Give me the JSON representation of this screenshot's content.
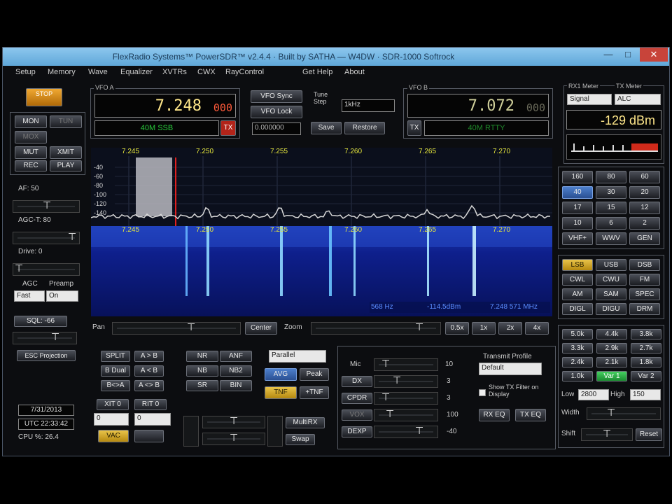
{
  "window": {
    "title": "FlexRadio Systems™ PowerSDR™ v2.4.4 · Built by SATHA — W4DW · SDR-1000 Softrock",
    "min": "—",
    "max": "□",
    "close": "✕"
  },
  "menu": [
    "Setup",
    "Memory",
    "Wave",
    "Equalizer",
    "XVTRs",
    "CWX",
    "RayControl",
    "Get Help",
    "About"
  ],
  "left": {
    "start_label": "STOP",
    "mon": "MON",
    "tun": "TUN",
    "mox": "MOX",
    "mut": "MUT",
    "xmit": "XMIT",
    "rec": "REC",
    "play": "PLAY",
    "af_label": "AF: 50",
    "agc_t_label": "AGC-T: 80",
    "drive_label": "Drive: 0",
    "agc_label": "AGC",
    "preamp_label": "Preamp",
    "agc_value": "Fast",
    "preamp_value": "On",
    "sql_label": "SQL: -66",
    "esc_label": "ESC Projection",
    "date": "7/31/2013",
    "utc": "UTC 22:33:42",
    "cpu": "CPU %: 26.4"
  },
  "vfo_a": {
    "group": "VFO A",
    "freq": "7.248",
    "freq_sub": "000",
    "mode": "40M SSB",
    "tx_badge": "TX"
  },
  "vfo_b": {
    "group": "VFO B",
    "freq": "7.072",
    "freq_sub": "000",
    "mode": "40M RTTY",
    "tx_badge": "TX"
  },
  "vfo_mid": {
    "sync": "VFO Sync",
    "lock": "VFO Lock",
    "tune_step_label": "Tune Step",
    "tune_step": "1kHz",
    "offset": "0.000000",
    "save": "Save",
    "restore": "Restore"
  },
  "meters": {
    "rx_label": "RX1 Meter",
    "tx_label": "TX Meter",
    "rx_value": "Signal",
    "tx_value": "ALC",
    "dbm": "-129 dBm"
  },
  "panadapter": {
    "ticks": [
      "7.245",
      "7.250",
      "7.255",
      "7.260",
      "7.265",
      "7.270"
    ],
    "db_labels": [
      "-40",
      "-60",
      "-80",
      "-100",
      "-120",
      "-140"
    ],
    "status_left": "568 Hz",
    "status_mid": "-114.5dBm",
    "status_right": "7.248 571 MHz"
  },
  "bands": [
    "160",
    "80",
    "60",
    "40",
    "30",
    "20",
    "17",
    "15",
    "12",
    "10",
    "6",
    "2",
    "VHF+",
    "WWV",
    "GEN"
  ],
  "modes": [
    "LSB",
    "USB",
    "DSB",
    "CWL",
    "CWU",
    "FM",
    "AM",
    "SAM",
    "SPEC",
    "DIGL",
    "DIGU",
    "DRM"
  ],
  "filters": [
    "5.0k",
    "4.4k",
    "3.8k",
    "3.3k",
    "2.9k",
    "2.7k",
    "2.4k",
    "2.1k",
    "1.8k",
    "1.0k",
    "Var 1",
    "Var 2"
  ],
  "filter_ctrl": {
    "low_label": "Low",
    "low": "2800",
    "high_label": "High",
    "high": "150",
    "width_label": "Width",
    "shift_label": "Shift",
    "reset": "Reset"
  },
  "pan_row": {
    "pan": "Pan",
    "center": "Center",
    "zoom": "Zoom",
    "z1": "0.5x",
    "z2": "1x",
    "z3": "2x",
    "z4": "4x"
  },
  "split": {
    "split": "SPLIT",
    "a2b": "A > B",
    "beq": "B Dual",
    "b2a": "A < B",
    "swap": "B<>A",
    "ab": "A <> B",
    "xit": "XIT",
    "xit_v": "0",
    "rit": "RIT",
    "rit_v": "0",
    "xit_in": "0",
    "rit_in": "0",
    "vac": "VAC"
  },
  "dsp": {
    "nr": "NR",
    "anf": "ANF",
    "nb": "NB",
    "nb2": "NB2",
    "bin": "BIN",
    "sr": "SR",
    "mode": "Parallel",
    "avg": "AVG",
    "peak": "Peak",
    "tnf": "TNF",
    "tnf2": "+TNF",
    "mult_rx": "MultiRX",
    "swap": "Swap"
  },
  "tx": {
    "mic": "Mic",
    "mic_v": "10",
    "dx": "DX",
    "dx_v": "3",
    "cpdr": "CPDR",
    "cpdr_v": "3",
    "vox": "VOX",
    "vox_v": "100",
    "dexp": "DEXP",
    "dexp_v": "-40",
    "profile_label": "Transmit Profile",
    "profile": "Default",
    "show_filter": "Show TX Filter on Display",
    "rx_eq": "RX EQ",
    "tx_eq": "TX EQ"
  }
}
